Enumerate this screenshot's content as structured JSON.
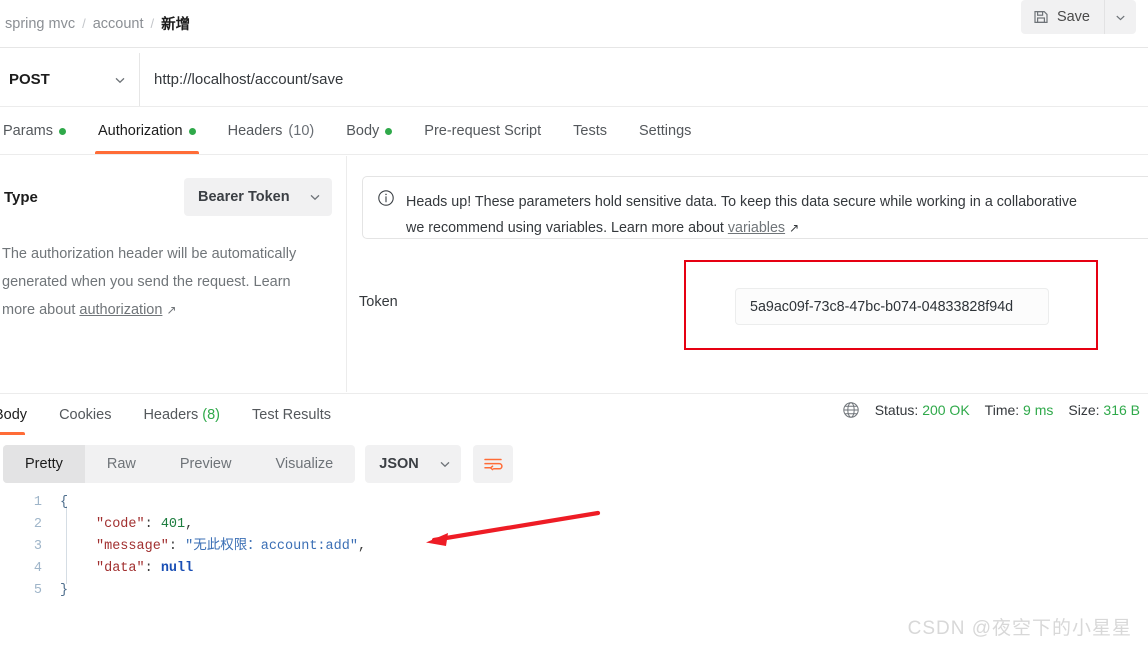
{
  "header": {
    "breadcrumb": [
      "spring mvc",
      "account",
      "新增"
    ],
    "separator": "/",
    "save_label": "Save",
    "save_icon": "floppy-disk-icon",
    "save_caret_icon": "chevron-down-icon"
  },
  "urlbar": {
    "method": "POST",
    "method_caret_icon": "chevron-down-icon",
    "url": "http://localhost/account/save"
  },
  "request_tabs": [
    {
      "label": "Params",
      "dot": true,
      "count": "",
      "active": false
    },
    {
      "label": "Authorization",
      "dot": true,
      "count": "",
      "active": true
    },
    {
      "label": "Headers",
      "dot": false,
      "count": "(10)",
      "active": false
    },
    {
      "label": "Body",
      "dot": true,
      "count": "",
      "active": false
    },
    {
      "label": "Pre-request Script",
      "dot": false,
      "count": "",
      "active": false
    },
    {
      "label": "Tests",
      "dot": false,
      "count": "",
      "active": false
    },
    {
      "label": "Settings",
      "dot": false,
      "count": "",
      "active": false
    }
  ],
  "auth": {
    "type_label": "Type",
    "type_value": "Bearer Token",
    "type_caret_icon": "chevron-down-icon",
    "help_text_1": "The authorization header will be automatically",
    "help_text_2": "generated when you send the request. Learn",
    "help_text_3": "more about ",
    "help_link": "authorization",
    "external_link_icon": "external-link-arrow-icon",
    "notice_icon": "info-circle-icon",
    "notice_line1": "Heads up! These parameters hold sensitive data. To keep this data secure while working in a collaborative",
    "notice_line2_pre": "we recommend using variables. Learn more about ",
    "notice_link": "variables",
    "token_label": "Token",
    "token_value": "5a9ac09f-73c8-47bc-b074-04833828f94d",
    "highlight_color": "#e60012"
  },
  "response_tabs": [
    {
      "label": "Body",
      "count": "",
      "active": true
    },
    {
      "label": "Cookies",
      "count": "",
      "active": false
    },
    {
      "label": "Headers",
      "count": "(8)",
      "active": false
    },
    {
      "label": "Test Results",
      "count": "",
      "active": false
    }
  ],
  "status": {
    "globe_icon": "globe-icon",
    "status_label": "Status:",
    "status_value": "200 OK",
    "time_label": "Time:",
    "time_value": "9 ms",
    "size_label": "Size:",
    "size_value": "316 B",
    "value_color": "#2fa94a"
  },
  "viewbar": {
    "modes": [
      {
        "label": "Pretty",
        "active": true
      },
      {
        "label": "Raw",
        "active": false
      },
      {
        "label": "Preview",
        "active": false
      },
      {
        "label": "Visualize",
        "active": false
      }
    ],
    "format": "JSON",
    "format_caret_icon": "chevron-down-icon",
    "wrap_icon": "word-wrap-icon"
  },
  "code": {
    "line_numbers": [
      "1",
      "2",
      "3",
      "4",
      "5"
    ],
    "open_brace": "{",
    "close_brace": "}",
    "lines": [
      {
        "key": "\"code\"",
        "colon": ": ",
        "value": "401",
        "value_type": "num",
        "trail": ","
      },
      {
        "key": "\"message\"",
        "colon": ": ",
        "value": "\"无此权限：account:add\"",
        "value_type": "str",
        "trail": ","
      },
      {
        "key": "\"data\"",
        "colon": ": ",
        "value": "null",
        "value_type": "nul",
        "trail": ""
      }
    ]
  },
  "annotation": {
    "arrow_color": "#ee1c25",
    "arrow_name": "red-arrow-annotation"
  },
  "watermark": "CSDN @夜空下的小星星"
}
